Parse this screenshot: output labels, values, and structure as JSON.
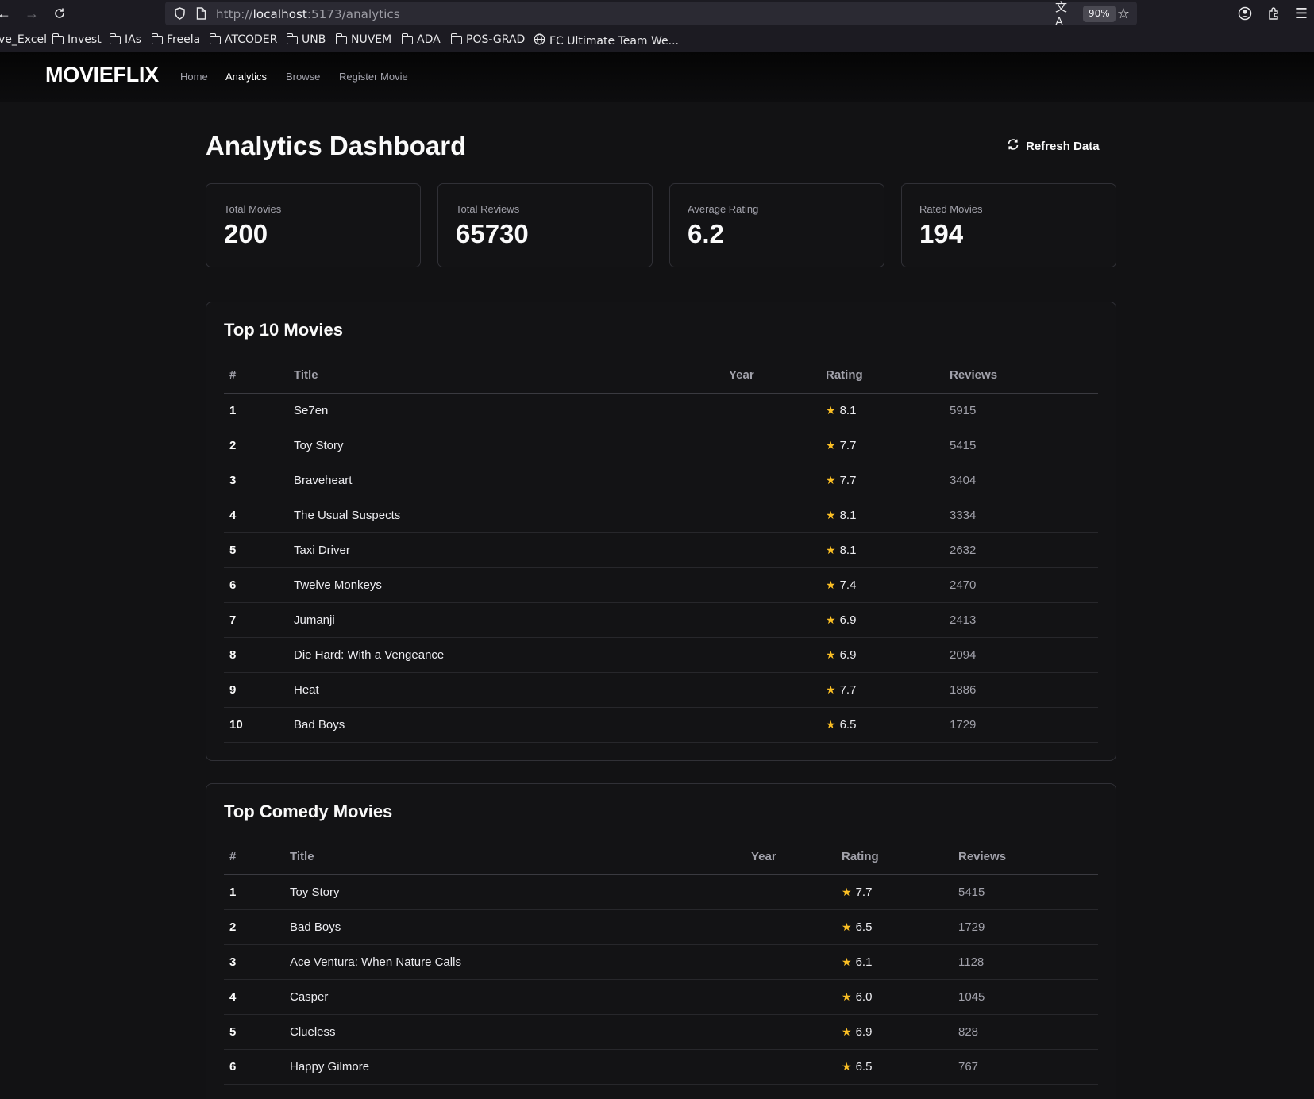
{
  "browser": {
    "url_scheme": "http://",
    "url_host": "localhost",
    "url_rest": ":5173/analytics",
    "zoom": "90%",
    "bookmarks": [
      {
        "label": "ve_Excel",
        "icon": "none"
      },
      {
        "label": "Invest",
        "icon": "folder-icon"
      },
      {
        "label": "IAs",
        "icon": "folder-icon"
      },
      {
        "label": "Freela",
        "icon": "folder-icon"
      },
      {
        "label": "ATCODER",
        "icon": "folder-icon"
      },
      {
        "label": "UNB",
        "icon": "folder-icon"
      },
      {
        "label": "NUVEM",
        "icon": "folder-icon"
      },
      {
        "label": "ADA",
        "icon": "folder-icon"
      },
      {
        "label": "POS-GRAD",
        "icon": "folder-icon"
      },
      {
        "label": "FC Ultimate Team We...",
        "icon": "globe-icon"
      }
    ]
  },
  "header": {
    "logo": "MOVIEFLIX",
    "nav": [
      {
        "label": "Home",
        "active": false
      },
      {
        "label": "Analytics",
        "active": true
      },
      {
        "label": "Browse",
        "active": false
      },
      {
        "label": "Register Movie",
        "active": false
      }
    ]
  },
  "page": {
    "title": "Analytics Dashboard",
    "refresh_label": "Refresh Data"
  },
  "stats": [
    {
      "label": "Total Movies",
      "value": "200"
    },
    {
      "label": "Total Reviews",
      "value": "65730"
    },
    {
      "label": "Average Rating",
      "value": "6.2"
    },
    {
      "label": "Rated Movies",
      "value": "194"
    }
  ],
  "top10": {
    "title": "Top 10 Movies",
    "columns": [
      "#",
      "Title",
      "Year",
      "Rating",
      "Reviews"
    ],
    "rows": [
      {
        "rank": "1",
        "title": "Se7en",
        "year": "",
        "rating": "8.1",
        "reviews": "5915"
      },
      {
        "rank": "2",
        "title": "Toy Story",
        "year": "",
        "rating": "7.7",
        "reviews": "5415"
      },
      {
        "rank": "3",
        "title": "Braveheart",
        "year": "",
        "rating": "7.7",
        "reviews": "3404"
      },
      {
        "rank": "4",
        "title": "The Usual Suspects",
        "year": "",
        "rating": "8.1",
        "reviews": "3334"
      },
      {
        "rank": "5",
        "title": "Taxi Driver",
        "year": "",
        "rating": "8.1",
        "reviews": "2632"
      },
      {
        "rank": "6",
        "title": "Twelve Monkeys",
        "year": "",
        "rating": "7.4",
        "reviews": "2470"
      },
      {
        "rank": "7",
        "title": "Jumanji",
        "year": "",
        "rating": "6.9",
        "reviews": "2413"
      },
      {
        "rank": "8",
        "title": "Die Hard: With a Vengeance",
        "year": "",
        "rating": "6.9",
        "reviews": "2094"
      },
      {
        "rank": "9",
        "title": "Heat",
        "year": "",
        "rating": "7.7",
        "reviews": "1886"
      },
      {
        "rank": "10",
        "title": "Bad Boys",
        "year": "",
        "rating": "6.5",
        "reviews": "1729"
      }
    ]
  },
  "comedy": {
    "title": "Top Comedy Movies",
    "columns": [
      "#",
      "Title",
      "Year",
      "Rating",
      "Reviews"
    ],
    "rows": [
      {
        "rank": "1",
        "title": "Toy Story",
        "year": "",
        "rating": "7.7",
        "reviews": "5415"
      },
      {
        "rank": "2",
        "title": "Bad Boys",
        "year": "",
        "rating": "6.5",
        "reviews": "1729"
      },
      {
        "rank": "3",
        "title": "Ace Ventura: When Nature Calls",
        "year": "",
        "rating": "6.1",
        "reviews": "1128"
      },
      {
        "rank": "4",
        "title": "Casper",
        "year": "",
        "rating": "6.0",
        "reviews": "1045"
      },
      {
        "rank": "5",
        "title": "Clueless",
        "year": "",
        "rating": "6.9",
        "reviews": "828"
      },
      {
        "rank": "6",
        "title": "Happy Gilmore",
        "year": "",
        "rating": "6.5",
        "reviews": "767"
      }
    ]
  },
  "colors": {
    "background": "#121214",
    "star": "#fbbf24",
    "muted_text": "#a1a1aa",
    "border": "#303036"
  }
}
